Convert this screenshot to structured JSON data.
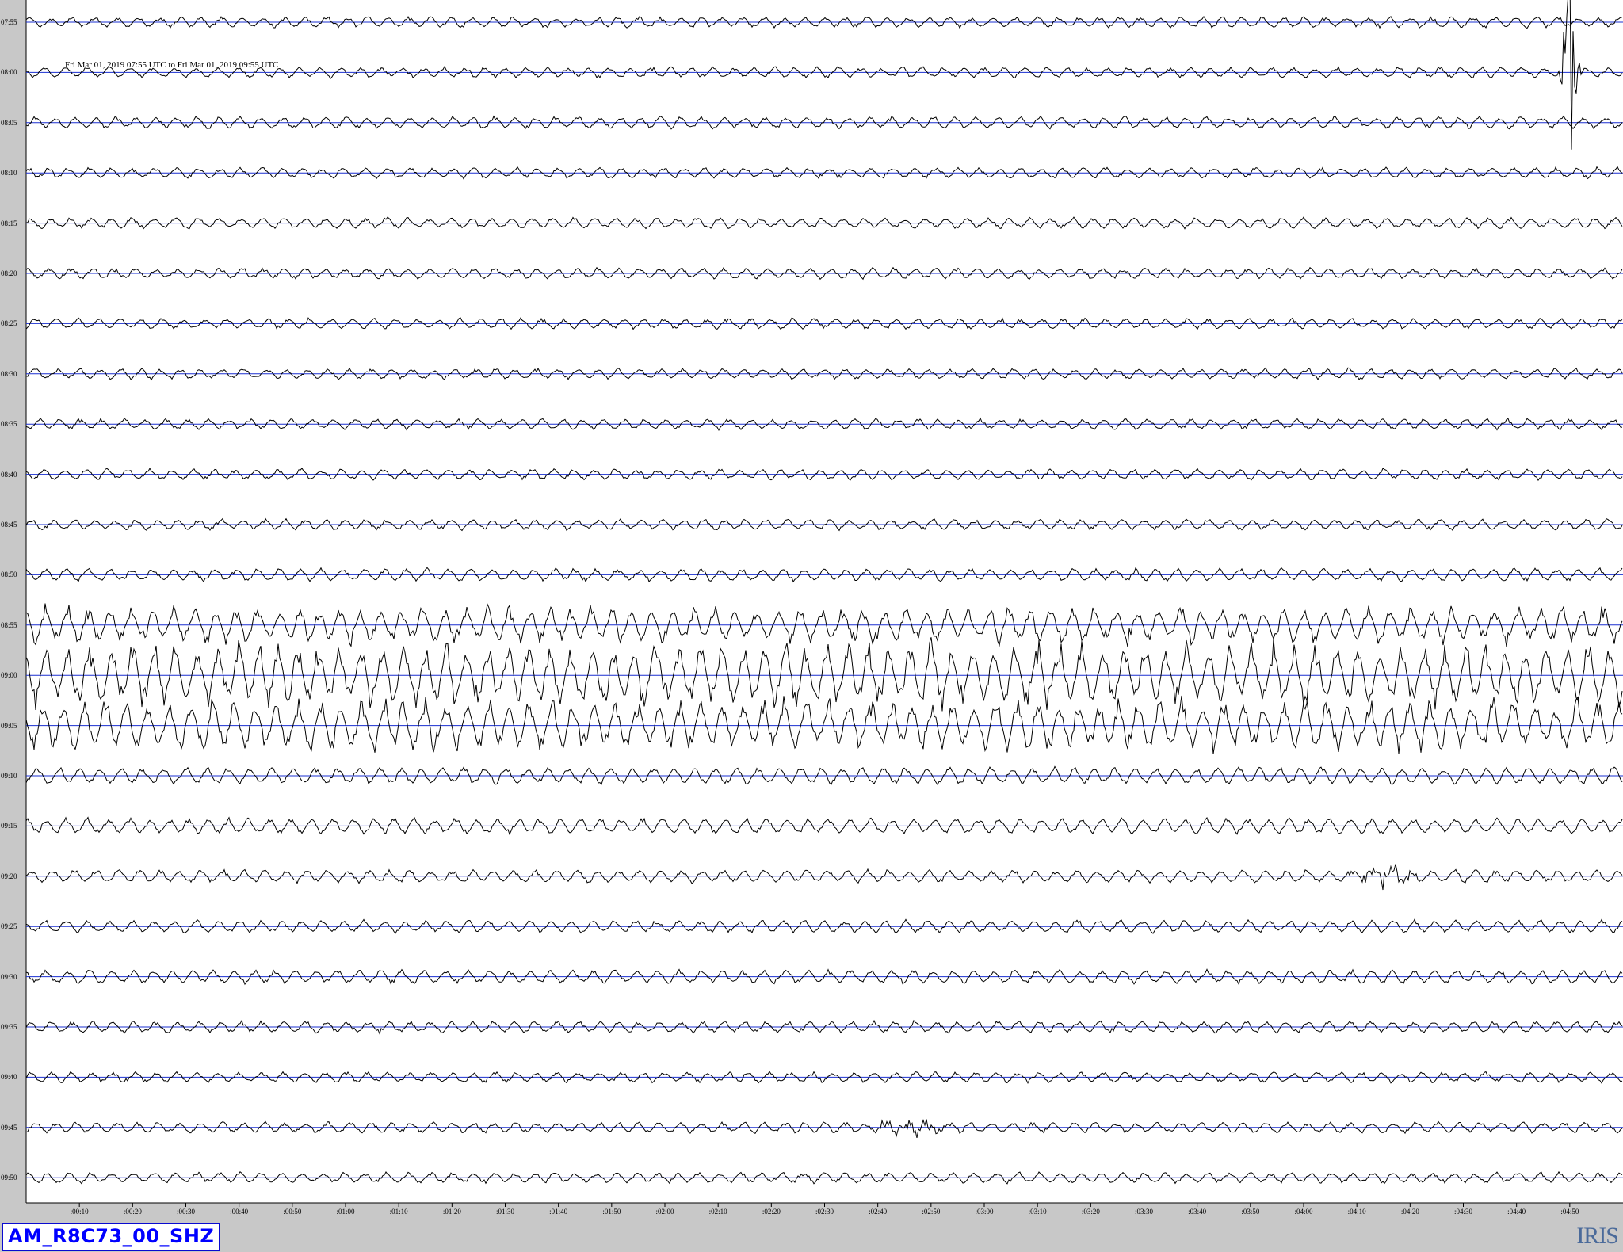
{
  "chart_data": {
    "type": "line",
    "title": "Fri Mar 01, 2019 07:55 UTC to Fri Mar 01, 2019 09:55 UTC",
    "station": "AM_R8C73_00_SHZ",
    "logo": "IRIS",
    "row_labels": [
      "07:55",
      "08:00",
      "08:05",
      "08:10",
      "08:15",
      "08:20",
      "08:25",
      "08:30",
      "08:35",
      "08:40",
      "08:45",
      "08:50",
      "08:55",
      "09:00",
      "09:05",
      "09:10",
      "09:15",
      "09:20",
      "09:25",
      "09:30",
      "09:35",
      "09:40",
      "09:45",
      "09:50"
    ],
    "x_tick_labels": [
      ":00:10",
      ":00:20",
      ":00:30",
      ":00:40",
      ":00:50",
      ":01:00",
      ":01:10",
      ":01:20",
      ":01:30",
      ":01:40",
      ":01:50",
      ":02:00",
      ":02:10",
      ":02:20",
      ":02:30",
      ":02:40",
      ":02:50",
      ":03:00",
      ":03:10",
      ":03:20",
      ":03:30",
      ":03:40",
      ":03:50",
      ":04:00",
      ":04:10",
      ":04:20",
      ":04:30",
      ":04:40",
      ":04:50"
    ],
    "x_range_seconds": [
      0,
      300
    ],
    "trace_amplitude_level": [
      1,
      1,
      1.1,
      1,
      1,
      1,
      1,
      1,
      1,
      1,
      1,
      1.2,
      3.2,
      5.5,
      4.5,
      1.6,
      1.5,
      1.2,
      1.2,
      1.3,
      1.1,
      1,
      1,
      1
    ],
    "events": [
      {
        "row": "08:00",
        "time_s": 290,
        "kind": "large spike"
      },
      {
        "row": "09:20",
        "time_s": 256,
        "kind": "burst"
      },
      {
        "row": "09:45",
        "time_s": 166,
        "kind": "burst"
      }
    ],
    "baseline_color": "#1a2fd0",
    "trace_color": "#000000",
    "background_color": "#ffffff",
    "grid": false
  }
}
